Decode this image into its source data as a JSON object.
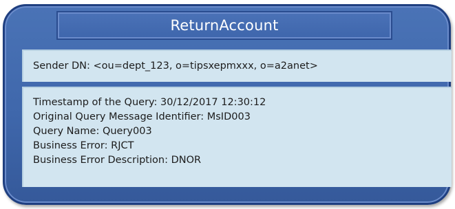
{
  "title": "ReturnAccount",
  "sender": "Sender DN: <ou=dept_123, o=tipsxepmxxx, o=a2anet>",
  "details": [
    "Timestamp of the Query: 30/12/2017 12:30:12",
    "Original Query Message Identifier: MsID003",
    "Query Name: Query003",
    "Business Error: RJCT",
    "Business Error Description: DNOR"
  ]
}
